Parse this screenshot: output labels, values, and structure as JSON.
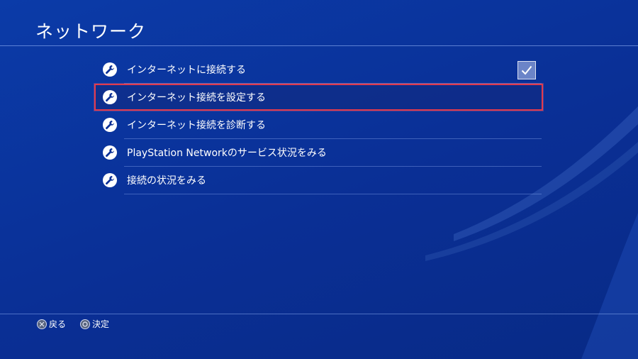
{
  "header": {
    "title": "ネットワーク"
  },
  "menu": {
    "items": [
      {
        "label": "インターネットに接続する",
        "icon": "wrench-icon",
        "checked": true
      },
      {
        "label": "インターネット接続を設定する",
        "icon": "wrench-icon",
        "selected": true
      },
      {
        "label": "インターネット接続を診断する",
        "icon": "wrench-icon"
      },
      {
        "label": "PlayStation Networkのサービス状況をみる",
        "icon": "wrench-icon"
      },
      {
        "label": "接続の状況をみる",
        "icon": "wrench-icon"
      }
    ]
  },
  "footer": {
    "back_label": "戻る",
    "back_icon": "cross-button-icon",
    "confirm_label": "決定",
    "confirm_icon": "circle-button-icon"
  },
  "colors": {
    "background": "#0a2f95",
    "selection_border": "#e23a4e",
    "checkbox_fill": "#6b84c8"
  }
}
